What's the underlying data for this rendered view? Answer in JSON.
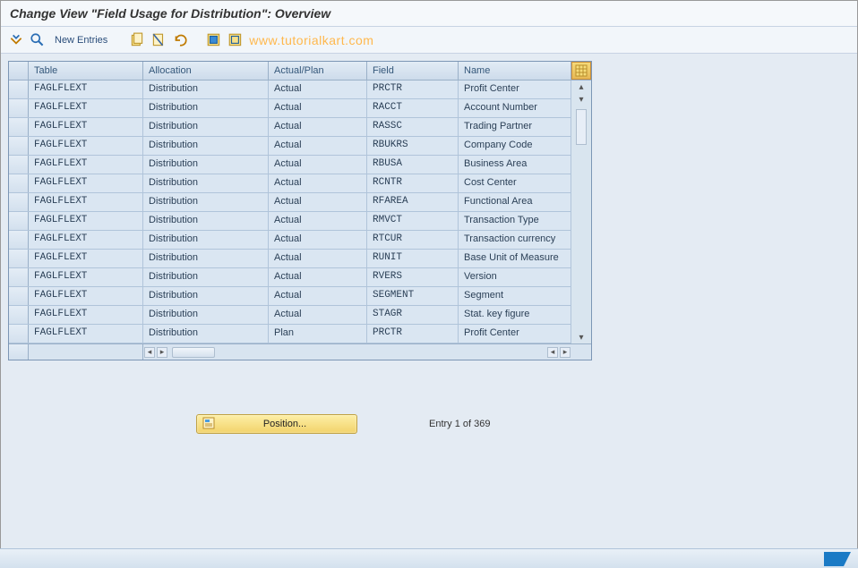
{
  "title": "Change View \"Field Usage for Distribution\": Overview",
  "toolbar": {
    "new_entries": "New Entries"
  },
  "watermark": "www.tutorialkart.com",
  "table": {
    "headers": {
      "table": "Table",
      "allocation": "Allocation",
      "actual_plan": "Actual/Plan",
      "field": "Field",
      "name": "Name"
    },
    "rows": [
      {
        "table": "FAGLFLEXT",
        "allocation": "Distribution",
        "ap": "Actual",
        "field": "PRCTR",
        "name": "Profit Center"
      },
      {
        "table": "FAGLFLEXT",
        "allocation": "Distribution",
        "ap": "Actual",
        "field": "RACCT",
        "name": "Account Number"
      },
      {
        "table": "FAGLFLEXT",
        "allocation": "Distribution",
        "ap": "Actual",
        "field": "RASSC",
        "name": "Trading Partner"
      },
      {
        "table": "FAGLFLEXT",
        "allocation": "Distribution",
        "ap": "Actual",
        "field": "RBUKRS",
        "name": "Company Code"
      },
      {
        "table": "FAGLFLEXT",
        "allocation": "Distribution",
        "ap": "Actual",
        "field": "RBUSA",
        "name": "Business Area"
      },
      {
        "table": "FAGLFLEXT",
        "allocation": "Distribution",
        "ap": "Actual",
        "field": "RCNTR",
        "name": "Cost Center"
      },
      {
        "table": "FAGLFLEXT",
        "allocation": "Distribution",
        "ap": "Actual",
        "field": "RFAREA",
        "name": "Functional Area"
      },
      {
        "table": "FAGLFLEXT",
        "allocation": "Distribution",
        "ap": "Actual",
        "field": "RMVCT",
        "name": "Transaction Type"
      },
      {
        "table": "FAGLFLEXT",
        "allocation": "Distribution",
        "ap": "Actual",
        "field": "RTCUR",
        "name": "Transaction currency"
      },
      {
        "table": "FAGLFLEXT",
        "allocation": "Distribution",
        "ap": "Actual",
        "field": "RUNIT",
        "name": "Base Unit of Measure"
      },
      {
        "table": "FAGLFLEXT",
        "allocation": "Distribution",
        "ap": "Actual",
        "field": "RVERS",
        "name": "Version"
      },
      {
        "table": "FAGLFLEXT",
        "allocation": "Distribution",
        "ap": "Actual",
        "field": "SEGMENT",
        "name": "Segment"
      },
      {
        "table": "FAGLFLEXT",
        "allocation": "Distribution",
        "ap": "Actual",
        "field": "STAGR",
        "name": "Stat. key figure"
      },
      {
        "table": "FAGLFLEXT",
        "allocation": "Distribution",
        "ap": "Plan",
        "field": "PRCTR",
        "name": "Profit Center"
      }
    ]
  },
  "position": {
    "label": "Position...",
    "entry_text": "Entry 1 of 369"
  }
}
